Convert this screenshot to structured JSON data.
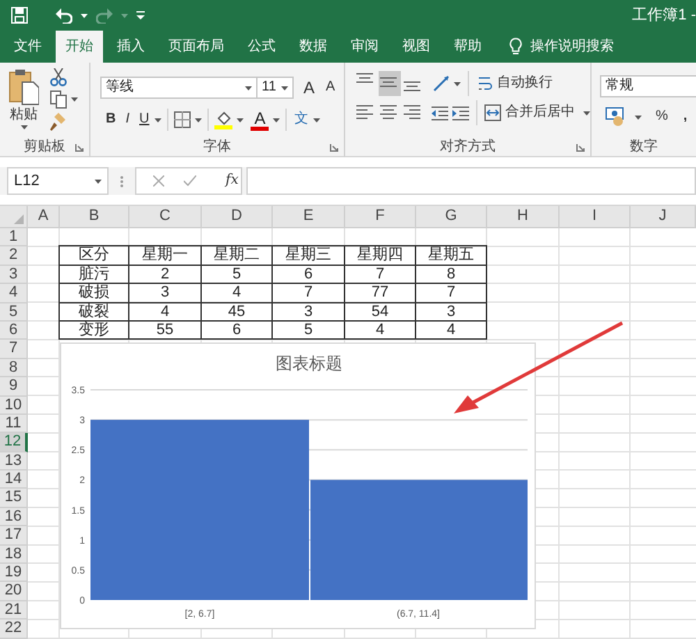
{
  "window": {
    "title": "工作簿1 -"
  },
  "tabs": [
    {
      "label": "文件",
      "selected": false
    },
    {
      "label": "开始",
      "selected": true
    },
    {
      "label": "插入",
      "selected": false
    },
    {
      "label": "页面布局",
      "selected": false
    },
    {
      "label": "公式",
      "selected": false
    },
    {
      "label": "数据",
      "selected": false
    },
    {
      "label": "审阅",
      "selected": false
    },
    {
      "label": "视图",
      "selected": false
    },
    {
      "label": "帮助",
      "selected": false
    }
  ],
  "tell_me": {
    "label": "操作说明搜索"
  },
  "ribbon": {
    "clipboard": {
      "paste": "粘贴",
      "group_label": "剪贴板"
    },
    "font": {
      "font_name": "等线",
      "font_size": "11",
      "grow": "A",
      "shrink": "A",
      "bold": "B",
      "italic": "I",
      "underline": "U",
      "font_color": "A",
      "phonetic": "文",
      "group_label": "字体"
    },
    "alignment": {
      "vertical": [
        {
          "kind": "top",
          "selected": false
        },
        {
          "kind": "middle",
          "selected": true
        },
        {
          "kind": "bottom",
          "selected": false
        }
      ],
      "horizontal": [
        {
          "kind": "left",
          "selected": false
        },
        {
          "kind": "center",
          "selected": false
        },
        {
          "kind": "right",
          "selected": false
        }
      ],
      "wrap_text": "自动换行",
      "merge_center": "合并后居中",
      "group_label": "对齐方式"
    },
    "number": {
      "format": "常规",
      "percent": "%",
      "comma": ",",
      "group_label": "数字"
    }
  },
  "formula_bar": {
    "name_box": "L12",
    "function_label": "fx"
  },
  "sheet": {
    "columns": [
      "A",
      "B",
      "C",
      "D",
      "E",
      "F",
      "G",
      "H",
      "I",
      "J"
    ],
    "rows": [
      {
        "label": "1",
        "selected": false
      },
      {
        "label": "2",
        "selected": false
      },
      {
        "label": "3",
        "selected": false
      },
      {
        "label": "4",
        "selected": false
      },
      {
        "label": "5",
        "selected": false
      },
      {
        "label": "6",
        "selected": false
      },
      {
        "label": "7",
        "selected": false
      },
      {
        "label": "8",
        "selected": false
      },
      {
        "label": "9",
        "selected": false
      },
      {
        "label": "10",
        "selected": false
      },
      {
        "label": "11",
        "selected": false
      },
      {
        "label": "12",
        "selected": true
      },
      {
        "label": "13",
        "selected": false
      },
      {
        "label": "14",
        "selected": false
      },
      {
        "label": "15",
        "selected": false
      },
      {
        "label": "16",
        "selected": false
      },
      {
        "label": "17",
        "selected": false
      },
      {
        "label": "18",
        "selected": false
      },
      {
        "label": "19",
        "selected": false
      },
      {
        "label": "20",
        "selected": false
      },
      {
        "label": "21",
        "selected": false
      },
      {
        "label": "22",
        "selected": false
      }
    ],
    "table": {
      "header": [
        "区分",
        "星期一",
        "星期二",
        "星期三",
        "星期四",
        "星期五"
      ],
      "rows": [
        [
          "脏污",
          "2",
          "5",
          "6",
          "7",
          "8"
        ],
        [
          "破损",
          "3",
          "4",
          "7",
          "77",
          "7"
        ],
        [
          "破裂",
          "4",
          "45",
          "3",
          "54",
          "3"
        ],
        [
          "变形",
          "55",
          "6",
          "5",
          "4",
          "4"
        ]
      ]
    },
    "chart_data": {
      "type": "bar",
      "title": "图表标题",
      "categories": [
        "[2, 6.7]",
        "(6.7, 11.4]"
      ],
      "series": [
        {
          "color": "#4472c4",
          "values": [
            3,
            2
          ]
        }
      ],
      "grid": true,
      "ylim": [
        0,
        3.5
      ],
      "yticks": [
        0,
        0.5,
        1,
        1.5,
        2,
        2.5,
        3,
        3.5
      ]
    }
  }
}
